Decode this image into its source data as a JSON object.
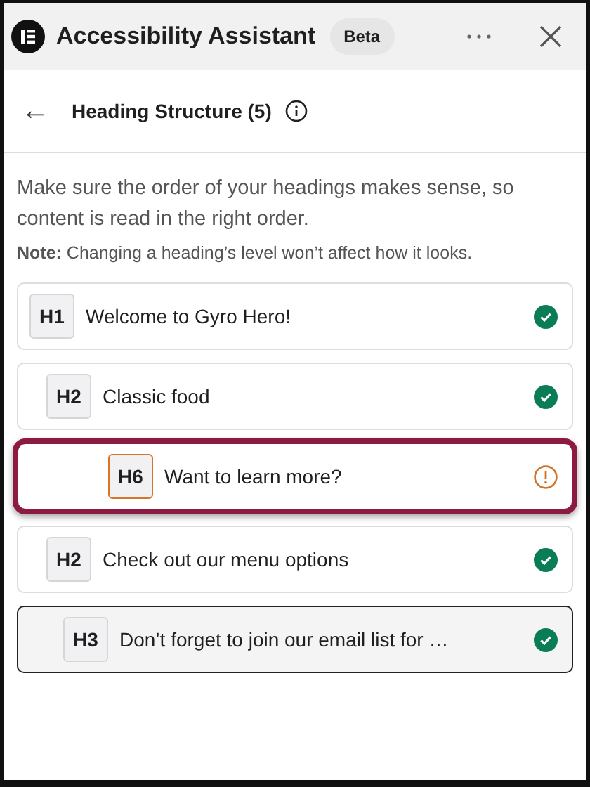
{
  "header": {
    "title": "Accessibility Assistant",
    "badge": "Beta"
  },
  "subheader": {
    "back": "←",
    "title": "Heading Structure (5)"
  },
  "description": "Make sure the order of your headings makes sense, so content is read in the right order.",
  "note": "**Note:** Changing a heading’s level won’t affect how it looks.",
  "headings": [
    {
      "tag": "H1",
      "text": "Welcome to Gyro Hero!",
      "kind": "ok",
      "selected": false,
      "highlighted": false
    },
    {
      "tag": "H2",
      "text": "Classic food",
      "kind": "ok",
      "selected": false,
      "highlighted": false
    },
    {
      "tag": "H6",
      "text": "Want to learn more?",
      "kind": "warning",
      "selected": false,
      "highlighted": true
    },
    {
      "tag": "H2",
      "text": "Check out our menu options",
      "kind": "ok",
      "selected": false,
      "highlighted": false
    },
    {
      "tag": "H3",
      "text": "Don’t forget to join our email list for …",
      "kind": "ok",
      "selected": true,
      "highlighted": false
    }
  ]
}
